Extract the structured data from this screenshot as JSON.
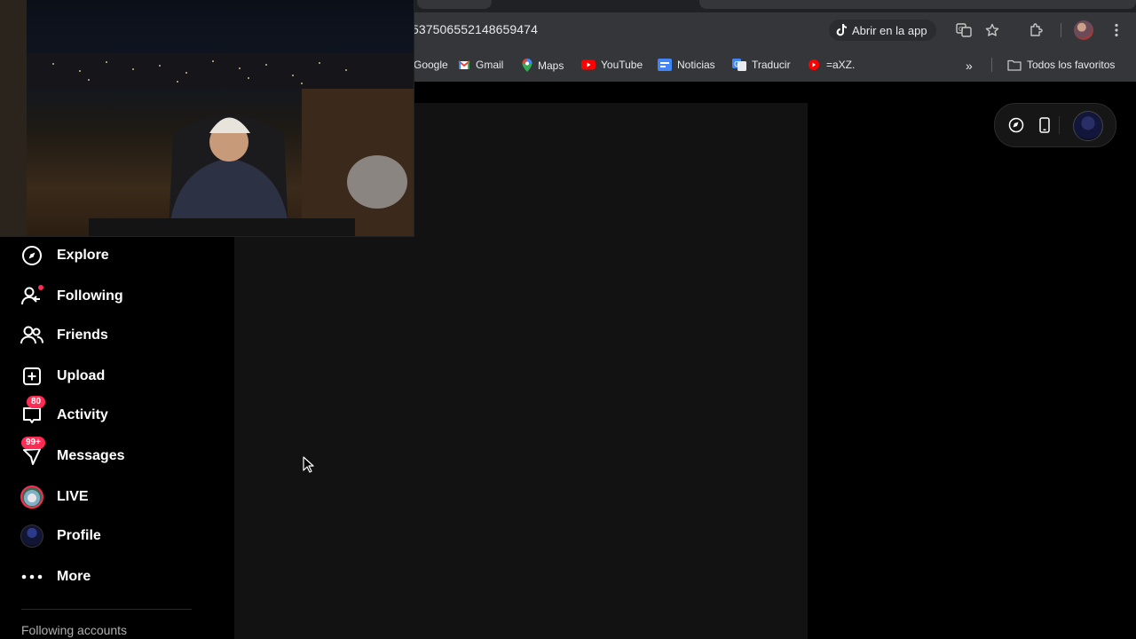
{
  "browser": {
    "url": "537506552148659474",
    "open_in_app": "Abrir en la app",
    "bookmarks": [
      {
        "label": "Google",
        "icon": "google-icon"
      },
      {
        "label": "Gmail",
        "icon": "gmail-icon"
      },
      {
        "label": "Maps",
        "icon": "maps-icon"
      },
      {
        "label": "YouTube",
        "icon": "youtube-icon"
      },
      {
        "label": "Noticias",
        "icon": "news-icon"
      },
      {
        "label": "Traducir",
        "icon": "translate-icon"
      },
      {
        "label": "=aXZ.",
        "icon": "youtube-icon"
      }
    ],
    "all_bookmarks": "Todos los favoritos",
    "bookmarks_more": "»"
  },
  "sidebar": {
    "items": [
      {
        "label": "Explore",
        "icon": "compass-icon"
      },
      {
        "label": "Following",
        "icon": "following-icon"
      },
      {
        "label": "Friends",
        "icon": "friends-icon"
      },
      {
        "label": "Upload",
        "icon": "upload-icon"
      },
      {
        "label": "Activity",
        "icon": "activity-icon",
        "badge": "80"
      },
      {
        "label": "Messages",
        "icon": "messages-icon",
        "badge": "99+"
      },
      {
        "label": "LIVE",
        "icon": "live-icon"
      },
      {
        "label": "Profile",
        "icon": "profile-avatar"
      },
      {
        "label": "More",
        "icon": "more-icon"
      }
    ],
    "following_accounts_title": "Following accounts"
  },
  "colors": {
    "accent": "#fe2c55",
    "panel": "#121212",
    "chrome": "#35363a"
  }
}
